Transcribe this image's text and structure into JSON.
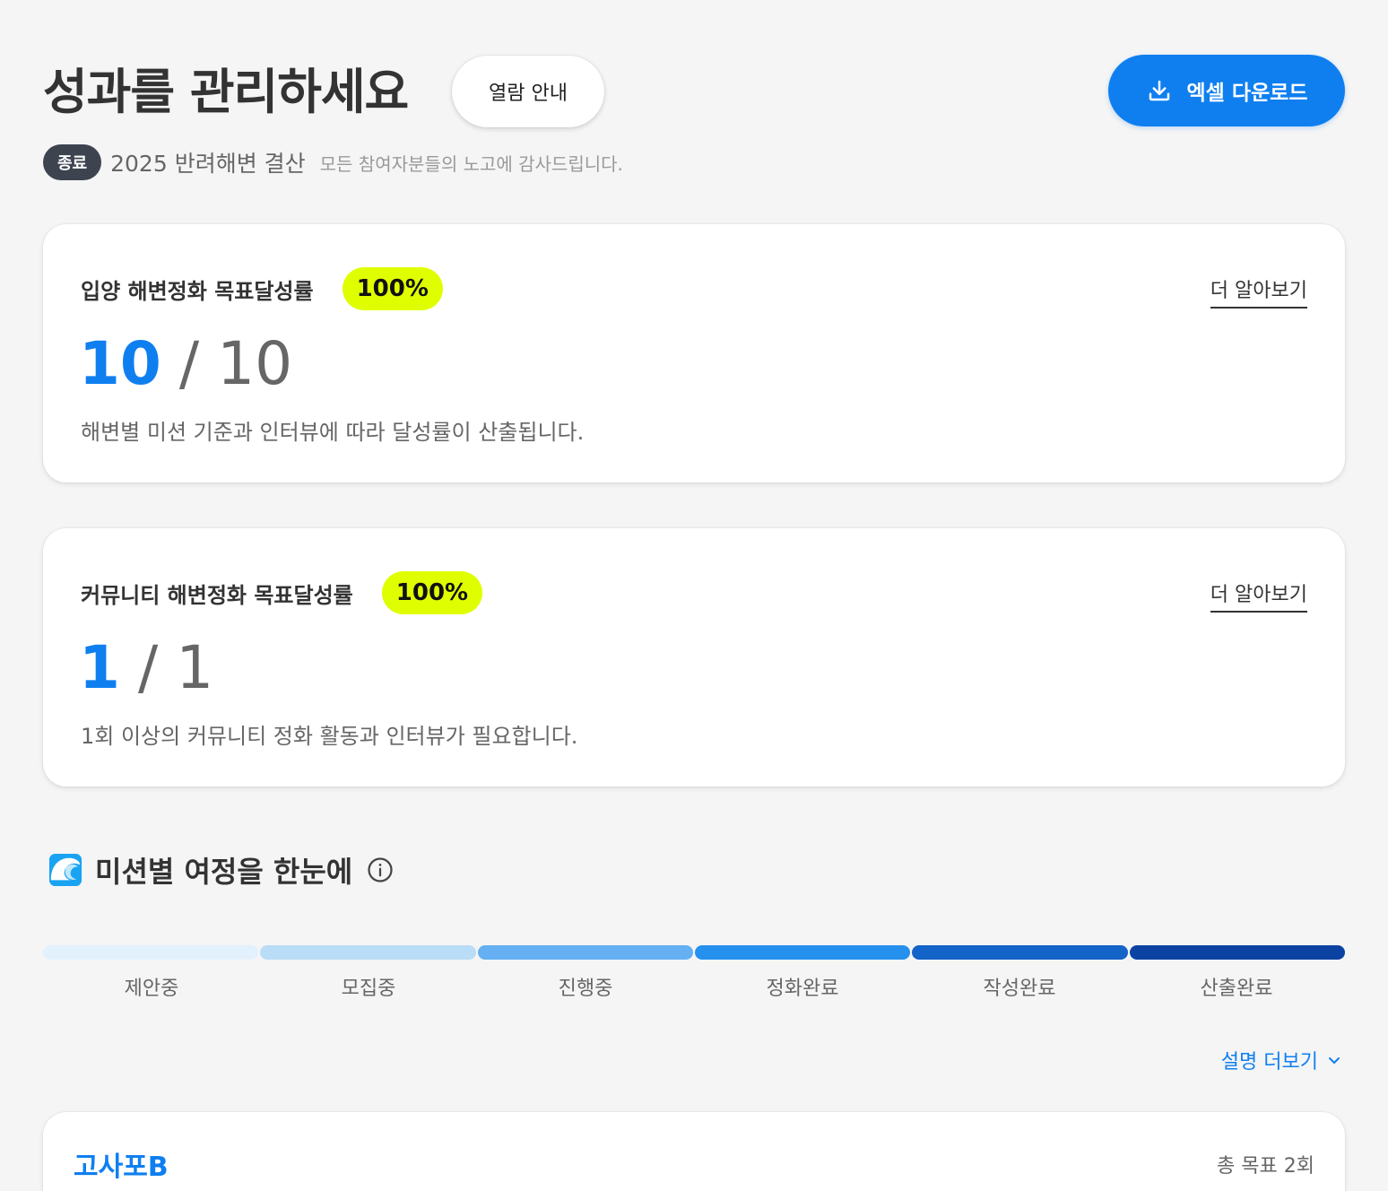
{
  "header": {
    "title": "성과를 관리하세요",
    "guide_button": "열람 안내",
    "excel_button": "엑셀 다운로드",
    "excel_icon": "download-icon"
  },
  "event": {
    "status": "종료",
    "name": "2025 반려해변 결산",
    "message": "모든 참여자분들의 노고에 감사드립니다."
  },
  "cards": [
    {
      "title": "입양 해변정화 목표달성률",
      "percent_label": "100%",
      "achieved": "10",
      "separator": "/",
      "total": "10",
      "description": "해변별 미션 기준과 인터뷰에 따라 달성률이 산출됩니다.",
      "link": "더 알아보기"
    },
    {
      "title": "커뮤니티 해변정화 목표달성률",
      "percent_label": "100%",
      "achieved": "1",
      "separator": "/",
      "total": "1",
      "description": "1회 이상의 커뮤니티 정화 활동과 인터뷰가 필요합니다.",
      "link": "더 알아보기"
    }
  ],
  "journey": {
    "title": "미션별 여정을 한눈에",
    "title_icon": "wave-icon",
    "info_icon": "info-icon",
    "stages": [
      "제안중",
      "모집중",
      "진행중",
      "정화완료",
      "작성완료",
      "산출완료"
    ],
    "stage_colors": [
      "#e3f1fd",
      "#b9dcf7",
      "#64b0f2",
      "#2690ee",
      "#1463c8",
      "#0c43a3"
    ],
    "more_label": "설명 더보기",
    "more_icon": "chevron-down-icon"
  },
  "beach": {
    "name": "고사포B",
    "goal": "총 목표 2회"
  },
  "colors": {
    "accent": "#0f7ff0",
    "badge_highlight": "#dfff00",
    "status_badge": "#3d4450",
    "background": "#f5f5f5"
  }
}
